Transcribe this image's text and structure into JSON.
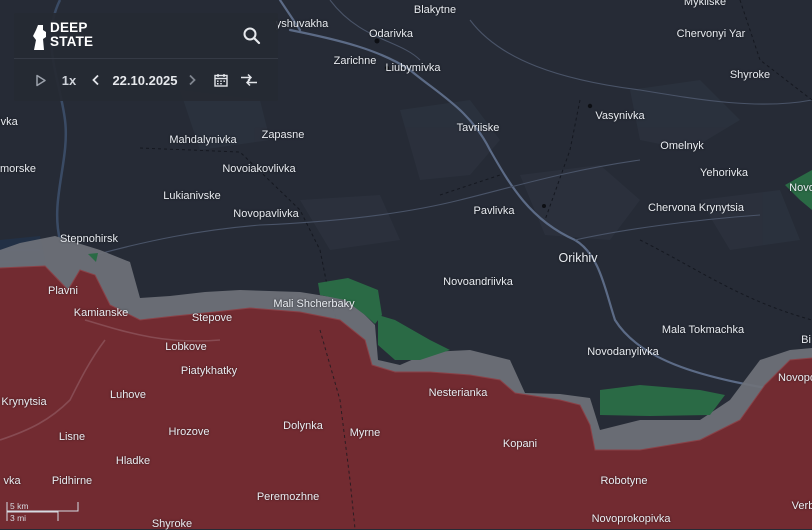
{
  "app": {
    "logo_line1": "DEEP",
    "logo_line2": "STATE"
  },
  "controls": {
    "speed": "1x",
    "date": "22.10.2025",
    "icons": [
      "play-icon",
      "prev-icon",
      "next-icon",
      "calendar-icon",
      "compare-icon",
      "search-icon"
    ]
  },
  "scale": {
    "metric": "5 km",
    "imperial": "3 mi"
  },
  "colors": {
    "map_background": "#262b36",
    "occupied": "#722b31",
    "contested": "#6f7279",
    "liberated": "#2a6a45",
    "roads": "#5c6b86"
  },
  "places": [
    {
      "name": "yshuvakha"
    },
    {
      "name": "Blakytne"
    },
    {
      "name": "Mykilske"
    },
    {
      "name": "Odarivka"
    },
    {
      "name": "Chervonyi Yar"
    },
    {
      "name": "Zarichne"
    },
    {
      "name": "Liubymivka"
    },
    {
      "name": "Shyroke"
    },
    {
      "name": "ivka"
    },
    {
      "name": "Vasynivka"
    },
    {
      "name": "Tavriiske"
    },
    {
      "name": "Zapasne"
    },
    {
      "name": "Mahdalynivka"
    },
    {
      "name": "Omelnyk"
    },
    {
      "name": "morske"
    },
    {
      "name": "Novoiakovlivka"
    },
    {
      "name": "Yehorivka"
    },
    {
      "name": "Novo"
    },
    {
      "name": "Lukianivske"
    },
    {
      "name": "Novopavlivka"
    },
    {
      "name": "Chervona Krynytsia"
    },
    {
      "name": "Pavlivka"
    },
    {
      "name": "Stepnohirsk"
    },
    {
      "name": "Orikhiv"
    },
    {
      "name": "Novoandriivka"
    },
    {
      "name": "Plavni"
    },
    {
      "name": "Mali Shcherbaky"
    },
    {
      "name": "Kamianske"
    },
    {
      "name": "Stepove"
    },
    {
      "name": "Mala Tokmachka"
    },
    {
      "name": "Lobkove"
    },
    {
      "name": "Novodanylivka"
    },
    {
      "name": "Piatykhatky"
    },
    {
      "name": "Novopo"
    },
    {
      "name": "Luhove"
    },
    {
      "name": "Nesterianka"
    },
    {
      "name": "Krynytsia"
    },
    {
      "name": "Lisne"
    },
    {
      "name": "Hrozove"
    },
    {
      "name": "Dolynka"
    },
    {
      "name": "Myrne"
    },
    {
      "name": "Kopani"
    },
    {
      "name": "Hladke"
    },
    {
      "name": "Pidhirne"
    },
    {
      "name": "Robotyne"
    },
    {
      "name": "vka"
    },
    {
      "name": "Peremozhne"
    },
    {
      "name": "Verb"
    },
    {
      "name": "Shyroke"
    },
    {
      "name": "Novoprokopivka"
    },
    {
      "name": "Bi"
    }
  ]
}
